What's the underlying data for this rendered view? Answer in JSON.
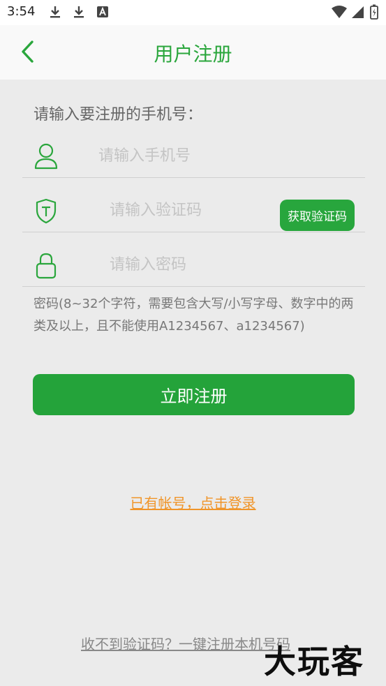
{
  "status_bar": {
    "time": "3:54",
    "left_icons": [
      "download-icon",
      "download-icon",
      "notification-a-icon"
    ],
    "right_icons": [
      "wifi-icon",
      "signal-icon",
      "battery-charging-icon"
    ]
  },
  "header": {
    "title": "用户注册",
    "back_icon": "chevron-left-icon"
  },
  "form": {
    "prompt": "请输入要注册的手机号：",
    "phone": {
      "placeholder": "请输入手机号",
      "value": "",
      "icon": "user-icon"
    },
    "code": {
      "placeholder": "请输入验证码",
      "value": "",
      "icon": "shield-icon",
      "button_label": "获取验证码"
    },
    "password": {
      "placeholder": "请输入密码",
      "value": "",
      "icon": "lock-icon"
    },
    "password_hint": "密码(8~32个字符，需要包含大写/小写字母、数字中的两类及以上，且不能使用A1234567、a1234567)",
    "submit_label": "立即注册"
  },
  "links": {
    "login": "已有帐号，点击登录",
    "no_code": "收不到验证码？一键注册本机号码"
  },
  "watermark": "大玩客",
  "colors": {
    "primary_green": "#24a33a",
    "link_orange": "#f0952a",
    "background": "#ebebeb"
  }
}
